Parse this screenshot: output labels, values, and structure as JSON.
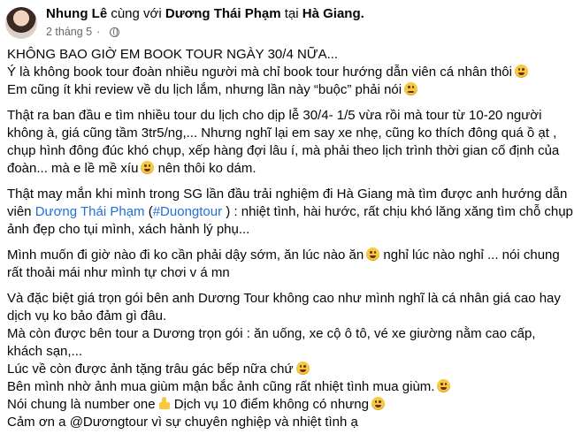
{
  "header": {
    "author": "Nhung Lê",
    "with_word": "cùng với",
    "tagged": "Dương Thái Phạm",
    "at_word": "tại",
    "place": "Hà Giang.",
    "time": "2 tháng 5",
    "sep": "·",
    "privacy_icon": "globe-icon"
  },
  "post": {
    "l1": "KHÔNG BAO GIỜ EM BOOK TOUR NGÀY 30/4 NỮA...",
    "l2": "Ý là không book tour đoàn nhiều người mà chỉ book tour hướng dẫn viên cá nhân thôi",
    "l3": "Em cũng ít khi review về du lịch lắm, nhưng lần này “buộc” phải nói",
    "p2": "Thật ra ban đầu e tìm nhiều tour du lịch cho dịp lễ 30/4- 1/5 vừa rồi mà tour từ 10-20 người không à, giá cũng tầm 3tr5/ng,... Nhưng nghĩ lại em say xe nhẹ, cũng ko thích đông quá ồ ạt , chụp hình đông đúc khó chụp, xếp hàng đợi lâu í, mà phải theo lịch trình thời gian cố định của đoàn... mà e lề mề xíu",
    "p2_end": "nên thôi ko dám.",
    "p3_a": "Thật may mắn khi mình trong SG lần đầu trải nghiệm đi Hà Giang mà tìm được anh hướng dẫn viên",
    "p3_link1": "Dương Thái Phạm",
    "p3_paren_open": "(",
    "p3_link2": "#Duongtour",
    "p3_b": ") : nhiệt tình, hài hước, rất chịu khó lăng xăng tìm chỗ chụp ảnh đẹp cho tụi mình, xách hành lý phụ...",
    "p4_a": "Mình muốn đi giờ nào đi ko cần phải dậy sớm, ăn lúc nào ăn",
    "p4_b": "nghỉ lúc nào nghỉ ... nói chung rất thoải mái như mình tự chơi v á mn",
    "p5": "Và đặc biệt giá trọn gói bên anh Dương Tour không cao như mình nghĩ là cá nhân giá cao hay dịch vụ ko bảo đảm gì đâu.",
    "p6": "Mà còn được bên tour a Dương trọn gói : ăn uống, xe cộ ô tô, vé xe giường nằm cao cấp, khách sạn,...",
    "p7": "Lúc về còn được ảnh tặng trâu gác bếp nữa chứ",
    "p8": "Bên mình nhờ ảnh mua giùm mận bắc ảnh cũng rất nhiệt tình mua giùm.",
    "p9_a": "Nói chung là number one",
    "p9_b": "Dịch vụ 10 điểm không có nhưng",
    "p10": "Cảm ơn a @Dươngtour vì sự chuyên nghiệp và nhiệt tình ạ"
  },
  "colors": {
    "link": "#216fdb",
    "muted": "#65676b",
    "text": "#050505"
  }
}
